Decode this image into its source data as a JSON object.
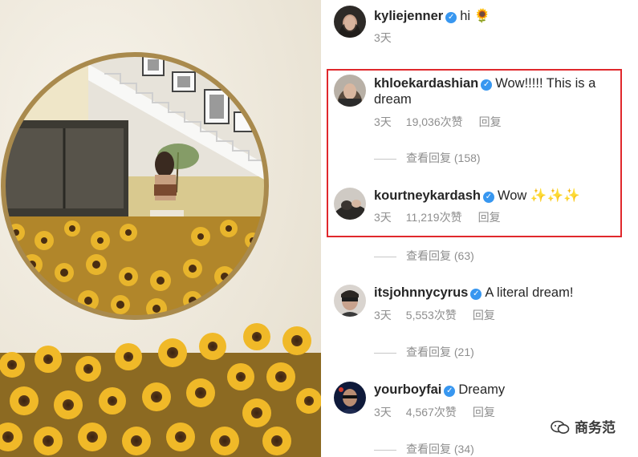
{
  "colors": {
    "verified_blue": "#3897f0",
    "highlight_red": "#e0282c",
    "meta_gray": "#8e8e8e"
  },
  "photo": {
    "alt_icon": "photo-of-mirror-and-sunflowers"
  },
  "comments": [
    {
      "username": "kyliejenner",
      "verified": true,
      "text": "hi 🌻",
      "time": "3天",
      "likes": "",
      "reply_label": ""
    },
    {
      "username": "khloekardashian",
      "verified": true,
      "text": "Wow!!!!! This is a dream",
      "time": "3天",
      "likes": "19,036次赞",
      "reply_label": "回复",
      "view_replies": "查看回复 (158)"
    },
    {
      "username": "kourtneykardash",
      "verified": true,
      "text": "Wow ✨✨✨",
      "time": "3天",
      "likes": "11,219次赞",
      "reply_label": "回复",
      "view_replies": "查看回复 (63)"
    },
    {
      "username": "itsjohnnycyrus",
      "verified": true,
      "text": "A literal dream!",
      "time": "3天",
      "likes": "5,553次赞",
      "reply_label": "回复",
      "view_replies": "查看回复 (21)"
    },
    {
      "username": "yourboyfai",
      "verified": true,
      "text": "Dreamy",
      "time": "3天",
      "likes": "4,567次赞",
      "reply_label": "回复",
      "view_replies": "查看回复 (34)"
    }
  ],
  "watermark": {
    "text": "商务范",
    "icon": "wechat-icon"
  }
}
